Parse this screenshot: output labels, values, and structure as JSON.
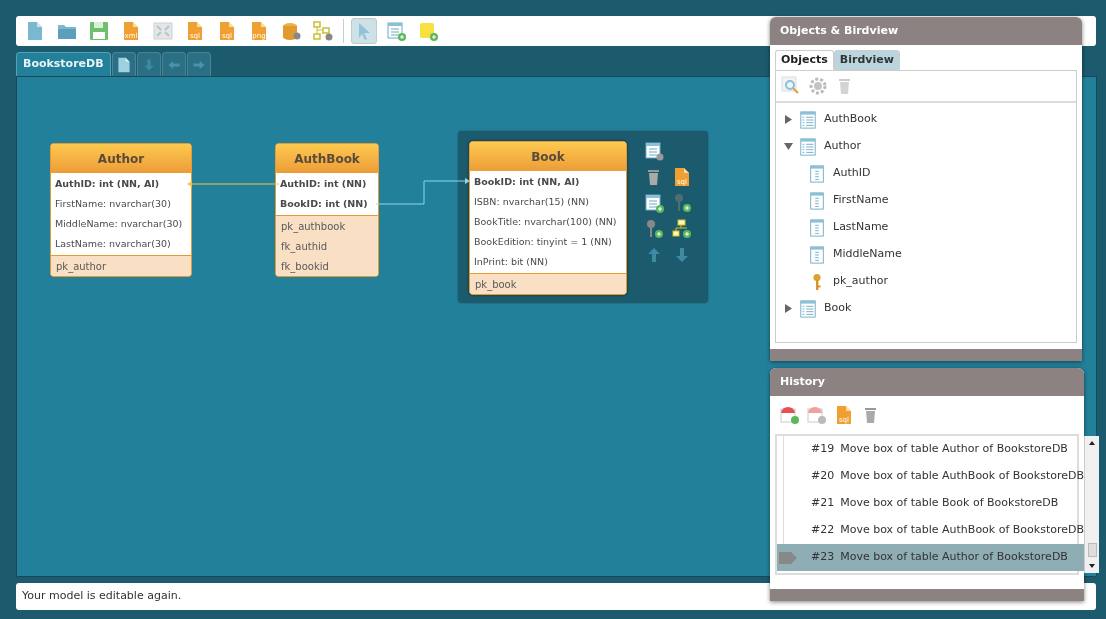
{
  "toolbar": [
    {
      "kind": "new",
      "selected": false
    },
    {
      "kind": "open",
      "selected": false
    },
    {
      "kind": "save",
      "selected": false
    },
    {
      "kind": "doc",
      "label": "xml",
      "selected": false
    },
    {
      "kind": "fit",
      "selected": false
    },
    {
      "kind": "doc",
      "label": "sql",
      "selected": false
    },
    {
      "kind": "doc",
      "label": "sql",
      "selected": false
    },
    {
      "kind": "doc",
      "label": "png",
      "selected": false
    },
    {
      "kind": "database",
      "selected": false
    },
    {
      "kind": "diagram",
      "selected": false
    },
    {
      "kind": "separator"
    },
    {
      "kind": "pointer",
      "selected": true
    },
    {
      "kind": "add-table",
      "selected": false
    },
    {
      "kind": "add-note",
      "selected": false
    }
  ],
  "tabs": [
    {
      "kind": "text",
      "label": "BookstoreDB",
      "selected": true
    },
    {
      "kind": "page",
      "selected": false
    },
    {
      "kind": "down",
      "selected": false
    },
    {
      "kind": "back",
      "selected": false
    },
    {
      "kind": "forward",
      "selected": false
    }
  ],
  "diagram": {
    "tables": [
      {
        "name": "Author",
        "selected": false,
        "columns": [
          {
            "text": "AuthID: int (NN, AI)",
            "key": true
          },
          {
            "text": "FirstName: nvarchar(30)",
            "key": false
          },
          {
            "text": "MiddleName: nvarchar(30)",
            "key": false
          },
          {
            "text": "LastName: nvarchar(30)",
            "key": false
          }
        ],
        "indexes": [
          "pk_author"
        ]
      },
      {
        "name": "AuthBook",
        "selected": false,
        "columns": [
          {
            "text": "AuthID: int (NN)",
            "key": true
          },
          {
            "text": "BookID: int (NN)",
            "key": true
          }
        ],
        "indexes": [
          "pk_authbook",
          "fk_authid",
          "fk_bookid"
        ]
      },
      {
        "name": "Book",
        "selected": true,
        "columns": [
          {
            "text": "BookID: int (NN, AI)",
            "key": true
          },
          {
            "text": "ISBN: nvarchar(15) (NN)",
            "key": false
          },
          {
            "text": "BookTitle: nvarchar(100) (NN)",
            "key": false
          },
          {
            "text": "BookEdition: tinyint = 1 (NN)",
            "key": false
          },
          {
            "text": "InPrint: bit (NN)",
            "key": false
          }
        ],
        "indexes": [
          "pk_book"
        ]
      }
    ],
    "context_tools": [
      {
        "kind": "edit-table"
      },
      {
        "kind": "blank"
      },
      {
        "kind": "delete"
      },
      {
        "kind": "sql",
        "label": "sql"
      },
      {
        "kind": "add-column"
      },
      {
        "kind": "add-fk-key"
      },
      {
        "kind": "add-key"
      },
      {
        "kind": "add-relation"
      },
      {
        "kind": "up"
      },
      {
        "kind": "down"
      }
    ]
  },
  "objects_panel": {
    "title": "Objects & Birdview",
    "tabs": [
      {
        "label": "Objects",
        "selected": true
      },
      {
        "label": "Birdview",
        "selected": false
      }
    ],
    "tree": [
      {
        "label": "AuthBook",
        "kind": "table",
        "expanded": false
      },
      {
        "label": "Author",
        "kind": "table",
        "expanded": true,
        "children": [
          {
            "label": "AuthID",
            "kind": "column"
          },
          {
            "label": "FirstName",
            "kind": "column"
          },
          {
            "label": "LastName",
            "kind": "column"
          },
          {
            "label": "MiddleName",
            "kind": "column"
          },
          {
            "label": "pk_author",
            "kind": "key"
          }
        ]
      },
      {
        "label": "Book",
        "kind": "table",
        "expanded": false
      }
    ]
  },
  "history_panel": {
    "title": "History",
    "entries": [
      {
        "number": "#19",
        "text": "Move box of table Author of BookstoreDB",
        "selected": false
      },
      {
        "number": "#20",
        "text": "Move box of table AuthBook of BookstoreDB",
        "selected": false
      },
      {
        "number": "#21",
        "text": "Move box of table Book of BookstoreDB",
        "selected": false
      },
      {
        "number": "#22",
        "text": "Move box of table AuthBook of BookstoreDB",
        "selected": false
      },
      {
        "number": "#23",
        "text": "Move box of table Author of BookstoreDB",
        "selected": true
      }
    ]
  },
  "status_bar": {
    "message": "Your model is editable again."
  }
}
